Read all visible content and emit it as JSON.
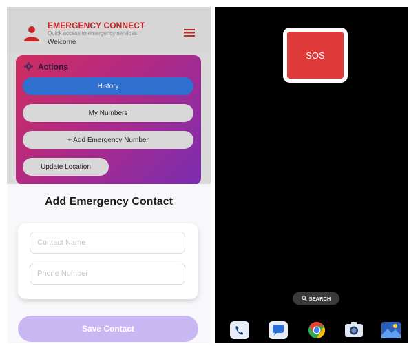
{
  "header": {
    "title": "EMERGENCY CONNECT",
    "subtitle": "Quick access to emergency services",
    "welcome": "Welcome",
    "icons": [
      "user-icon",
      "hamburger-menu-icon"
    ]
  },
  "actions": {
    "title": "Actions",
    "icon": "gear-icon",
    "buttons": {
      "history": "History",
      "my_numbers": "My Numbers",
      "add_emergency_number": "+ Add Emergency Number",
      "update_location": "Update Location"
    }
  },
  "add_contact": {
    "title": "Add Emergency Contact",
    "name_placeholder": "Contact Name",
    "phone_placeholder": "Phone Number",
    "save_label": "Save Contact"
  },
  "home_screen": {
    "sos_label": "SOS",
    "search_label": "SEARCH",
    "dock_icons": [
      "phone-icon",
      "messages-icon",
      "chrome-icon",
      "camera-icon",
      "gallery-icon"
    ]
  },
  "colors": {
    "brand_red": "#c62828",
    "sos_red": "#de3a3a",
    "history_blue": "#2f6fd0",
    "save_disabled": "#c9b7f3"
  }
}
